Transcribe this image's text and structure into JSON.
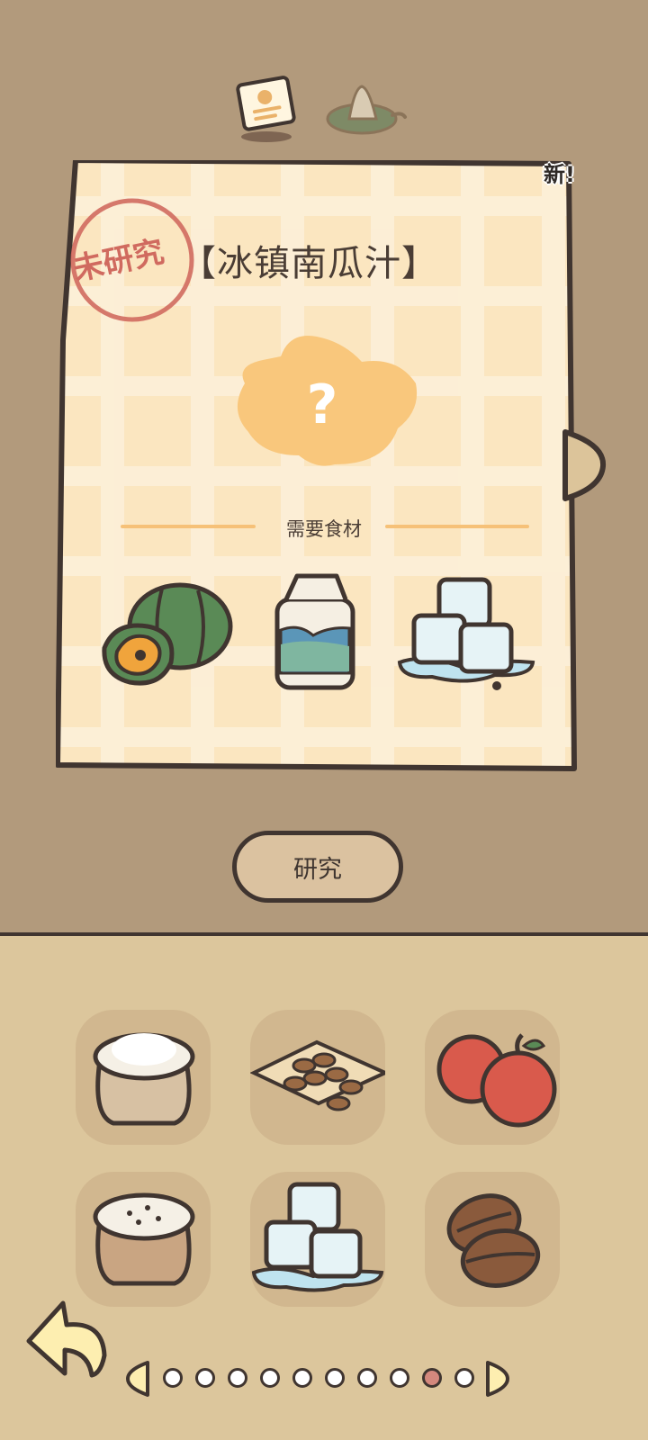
{
  "tabs": [
    {
      "name": "recipe-book-tab",
      "icon": "recipe-card-icon",
      "active": true
    },
    {
      "name": "food-tab",
      "icon": "rice-ball-icon",
      "active": false
    }
  ],
  "card": {
    "title": "【冰镇南瓜汁】",
    "stamp": "未研究",
    "new_badge": "新!",
    "mystery_icon": "question-blob-icon",
    "needs_label": "需要食材",
    "ingredients": [
      {
        "icon": "pumpkin-icon"
      },
      {
        "icon": "milk-carton-icon"
      },
      {
        "icon": "ice-cubes-icon"
      }
    ]
  },
  "actions": {
    "research_label": "研究"
  },
  "inventory": [
    {
      "icon": "flour-sack-icon"
    },
    {
      "icon": "almonds-icon"
    },
    {
      "icon": "apples-icon"
    },
    {
      "icon": "sugar-sack-icon"
    },
    {
      "icon": "ice-cubes-icon"
    },
    {
      "icon": "coffee-beans-icon"
    }
  ],
  "pagination": {
    "total": 10,
    "current": 9
  },
  "colors": {
    "background": "#b29a7c",
    "card": "#fbe6c0",
    "accent": "#f6c178",
    "stamp": "#d06a5f",
    "panel": "#dcc69c"
  }
}
